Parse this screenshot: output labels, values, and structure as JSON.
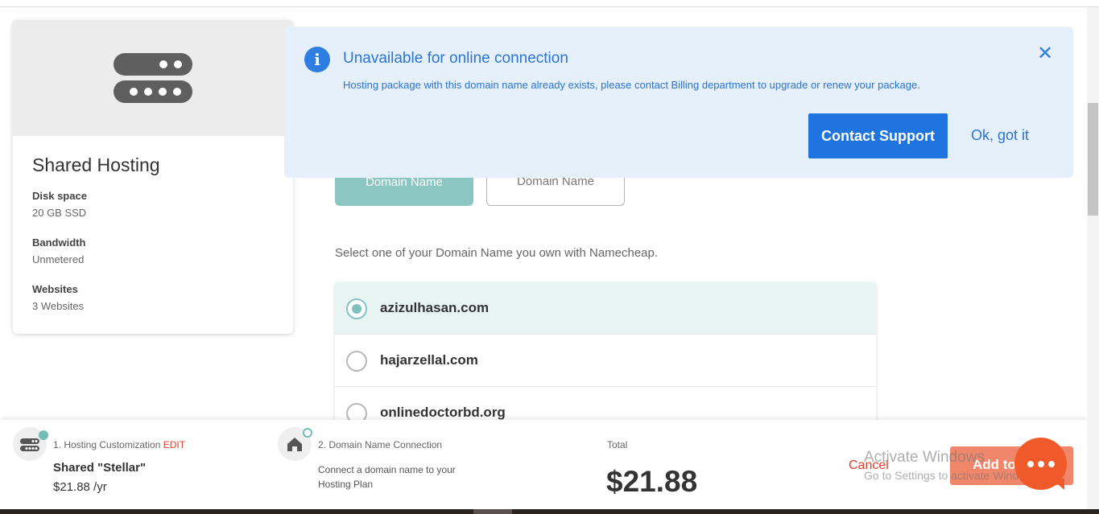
{
  "product": {
    "title": "Shared Hosting",
    "specs": [
      {
        "label": "Disk space",
        "value": "20 GB SSD"
      },
      {
        "label": "Bandwidth",
        "value": "Unmetered"
      },
      {
        "label": "Websites",
        "value": "3 Websites"
      }
    ]
  },
  "alert": {
    "title": "Unavailable for online connection",
    "message": "Hosting package with this domain name already exists, please contact Billing department to upgrade or renew your package.",
    "contact_button": "Contact Support",
    "ok_button": "Ok, got it",
    "close_glyph": "✕",
    "info_glyph": "i"
  },
  "domain_tabs": [
    "Domain Name",
    "Domain Name"
  ],
  "select_text": "Select one of your Domain Name you own with Namecheap.",
  "domains": [
    {
      "name": "azizulhasan.com",
      "selected": true
    },
    {
      "name": "hajarzellal.com",
      "selected": false
    },
    {
      "name": "onlinedoctorbd.org",
      "selected": false
    }
  ],
  "bottom": {
    "step1_label": "1. Hosting Customization",
    "step1_edit": "EDIT",
    "plan_name": "Shared \"Stellar\"",
    "plan_price": "$21.88 /yr",
    "step2_label": "2. Domain Name Connection",
    "step2_desc": "Connect a domain name to your Hosting Plan",
    "total_label": "Total",
    "total_value": "$21.88",
    "cancel": "Cancel",
    "add_button": "Add to",
    "watermark_line1": "Activate Windows",
    "watermark_line2": "Go to Settings to activate Windows."
  },
  "colors": {
    "accent_blue": "#1f74e0",
    "teal": "#8cc6c2",
    "alert_bg": "#e6f0fb",
    "cta_orange": "#f05a2a",
    "cancel_red": "#d9412c"
  }
}
